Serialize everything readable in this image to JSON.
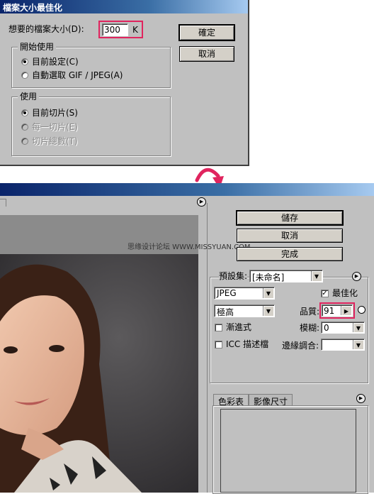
{
  "dialog": {
    "title": "檔案大小最佳化",
    "size_label": "想要的檔案大小(D):",
    "size_value": "300",
    "size_unit": "K",
    "ok_label": "確定",
    "cancel_label": "取消",
    "start_group": {
      "label": "開始使用",
      "options": [
        "目前設定(C)",
        "自動選取 GIF / JPEG(A)"
      ]
    },
    "use_group": {
      "label": "使用",
      "options": [
        "目前切片(S)",
        "每一切片(E)",
        "切片總數(T)"
      ]
    }
  },
  "main": {
    "save_label": "儲存",
    "cancel_label": "取消",
    "done_label": "完成",
    "watermark": "思缘设计论坛  WWW.MISSYUAN.COM",
    "preset_label": "預設集:",
    "preset_value": "[未命名]",
    "format_value": "JPEG",
    "optimized_label": "最佳化",
    "quality_level_value": "極高",
    "quality_label": "品質:",
    "quality_value": "91",
    "progressive_label": "漸進式",
    "blur_label": "模糊:",
    "blur_value": "0",
    "icc_label": "ICC 描述檔",
    "matte_label": "邊緣調合:",
    "tabs": [
      "色彩表",
      "影像尺寸"
    ]
  },
  "colors": {
    "highlight_red": "#e0245e",
    "arrow_red": "#e0245e",
    "title_blue": "#0a246a"
  }
}
